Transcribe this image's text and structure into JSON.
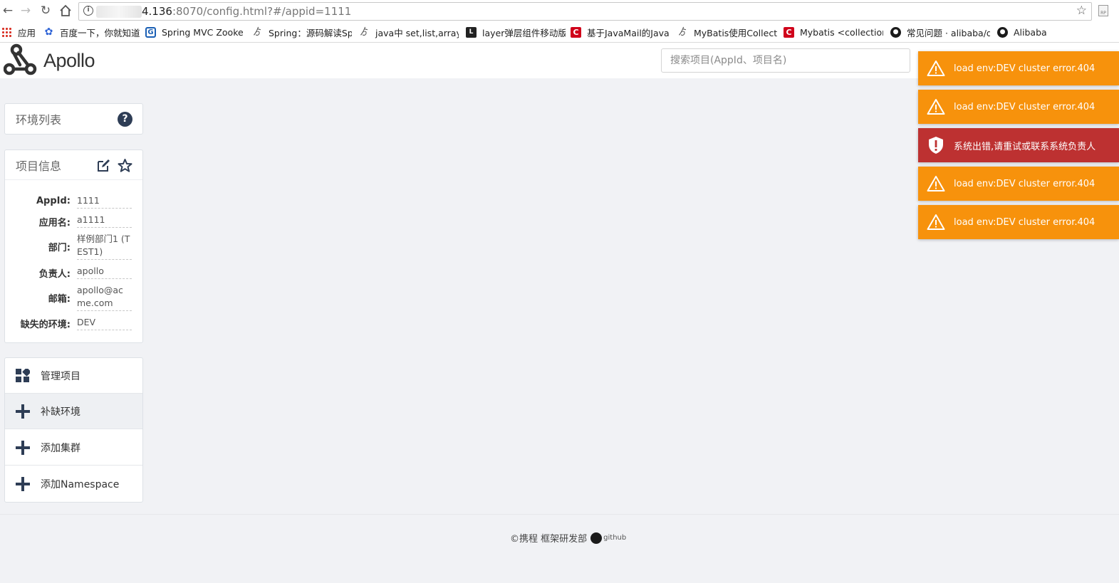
{
  "browser": {
    "url_host": "4.136",
    "url_rest": ":8070/config.html?#/appid=1111",
    "bookmarks": [
      {
        "label": "应用",
        "icon": "apps-grid-icon"
      },
      {
        "label": "百度一下，你就知道",
        "icon": "baidu-paw-icon"
      },
      {
        "label": "Spring MVC Zookee",
        "icon": "g-logo-icon"
      },
      {
        "label": "Spring：源码解读Sp",
        "icon": "spider-icon"
      },
      {
        "label": "java中 set,list,array(",
        "icon": "spider-icon"
      },
      {
        "label": "layer弹层组件移动版",
        "icon": "layer-logo-icon"
      },
      {
        "label": "基于JavaMail的Java",
        "icon": "csdn-icon"
      },
      {
        "label": "MyBatis使用Collecti",
        "icon": "spider-icon"
      },
      {
        "label": "Mybatis <collection",
        "icon": "csdn-icon"
      },
      {
        "label": "常见问题 · alibaba/d",
        "icon": "github-icon"
      },
      {
        "label": "Alibaba",
        "icon": "github-icon"
      }
    ]
  },
  "header": {
    "logo_text": "Apollo",
    "search_placeholder": "搜索项目(AppId、项目名)"
  },
  "env_panel": {
    "title": "环境列表",
    "help_glyph": "?"
  },
  "project_panel": {
    "title": "项目信息",
    "rows": [
      {
        "label": "AppId:",
        "value": "1111"
      },
      {
        "label": "应用名:",
        "value": "a1111"
      },
      {
        "label": "部门:",
        "value": "样例部门1 (TEST1)"
      },
      {
        "label": "负责人:",
        "value": "apollo"
      },
      {
        "label": "邮箱:",
        "value": "apollo@acme.com"
      },
      {
        "label": "缺失的环境:",
        "value": "DEV"
      }
    ]
  },
  "menu": [
    {
      "label": "管理项目",
      "icon": "dashboard-icon"
    },
    {
      "label": "补缺环境",
      "icon": "plus-icon"
    },
    {
      "label": "添加集群",
      "icon": "plus-icon"
    },
    {
      "label": "添加Namespace",
      "icon": "plus-icon"
    }
  ],
  "footer": {
    "text": "©携程 框架研发部",
    "github": "github"
  },
  "toasts": [
    {
      "type": "warning",
      "text": "load env:DEV cluster error.404"
    },
    {
      "type": "warning",
      "text": "load env:DEV cluster error.404"
    },
    {
      "type": "error",
      "text": "系统出错,请重试或联系系统负责人"
    },
    {
      "type": "warning",
      "text": "load env:DEV cluster error.404"
    },
    {
      "type": "warning",
      "text": "load env:DEV cluster error.404"
    }
  ],
  "colors": {
    "warning": "#f7920c",
    "error": "#bd3131",
    "icon_dark": "#2e3d55",
    "page_bg": "#f1f2f5"
  }
}
